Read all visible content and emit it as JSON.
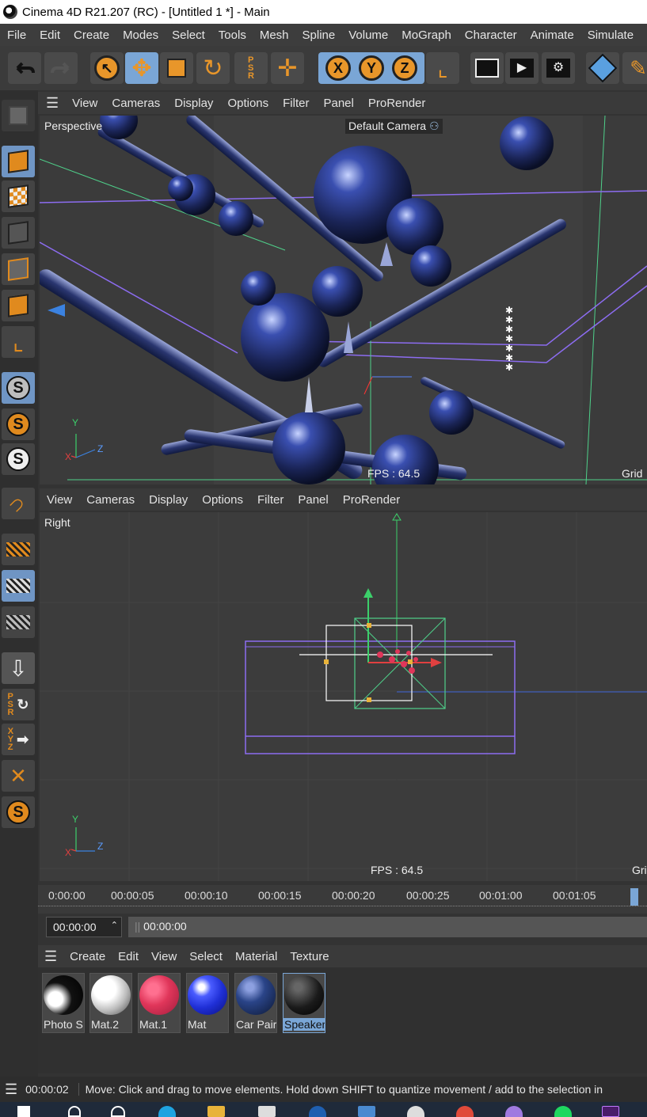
{
  "window": {
    "title": "Cinema 4D R21.207 (RC) - [Untitled 1 *] - Main"
  },
  "menu": [
    "File",
    "Edit",
    "Create",
    "Modes",
    "Select",
    "Tools",
    "Mesh",
    "Spline",
    "Volume",
    "MoGraph",
    "Character",
    "Animate",
    "Simulate"
  ],
  "toolbar": {
    "axis_x": "X",
    "axis_y": "Y",
    "axis_z": "Z",
    "psr_label": "P\nS\nR"
  },
  "viewport_top": {
    "menu": [
      "View",
      "Cameras",
      "Display",
      "Options",
      "Filter",
      "Panel",
      "ProRender"
    ],
    "name": "Perspective",
    "camera": "Default Camera",
    "fps": "FPS : 64.5",
    "grid": "Grid",
    "axis_y": "Y",
    "axis_z": "Z",
    "axis_x": "X"
  },
  "viewport_bottom": {
    "menu": [
      "View",
      "Cameras",
      "Display",
      "Options",
      "Filter",
      "Panel",
      "ProRender"
    ],
    "name": "Right",
    "fps": "FPS : 64.5",
    "grid": "Gri",
    "axis_y": "Y",
    "axis_z": "Z",
    "axis_x": "X"
  },
  "timeline": {
    "ticks": [
      "0:00:00",
      "00:00:05",
      "00:00:10",
      "00:00:15",
      "00:00:20",
      "00:00:25",
      "00:01:00",
      "00:01:05"
    ],
    "current_time": "00:00:00",
    "range_start": "00:00:00"
  },
  "material_manager": {
    "menu": [
      "Create",
      "Edit",
      "View",
      "Select",
      "Material",
      "Texture"
    ],
    "materials": [
      {
        "name": "Photo S",
        "color": "#0a0a0a"
      },
      {
        "name": "Mat.2",
        "color": "#e8e8e8"
      },
      {
        "name": "Mat.1",
        "color": "#e0365a"
      },
      {
        "name": "Mat",
        "color": "#1f2fd6"
      },
      {
        "name": "Car Pair",
        "color": "#1e3a78"
      },
      {
        "name": "Speaker",
        "color": "#1a1a1a"
      }
    ],
    "selected": "Speaker"
  },
  "status": {
    "time": "00:00:02",
    "message": "Move: Click and drag to move elements. Hold down SHIFT to quantize movement / add to the selection in"
  },
  "left_tools": {
    "psr": "PSR",
    "xyz": "XYZ"
  }
}
